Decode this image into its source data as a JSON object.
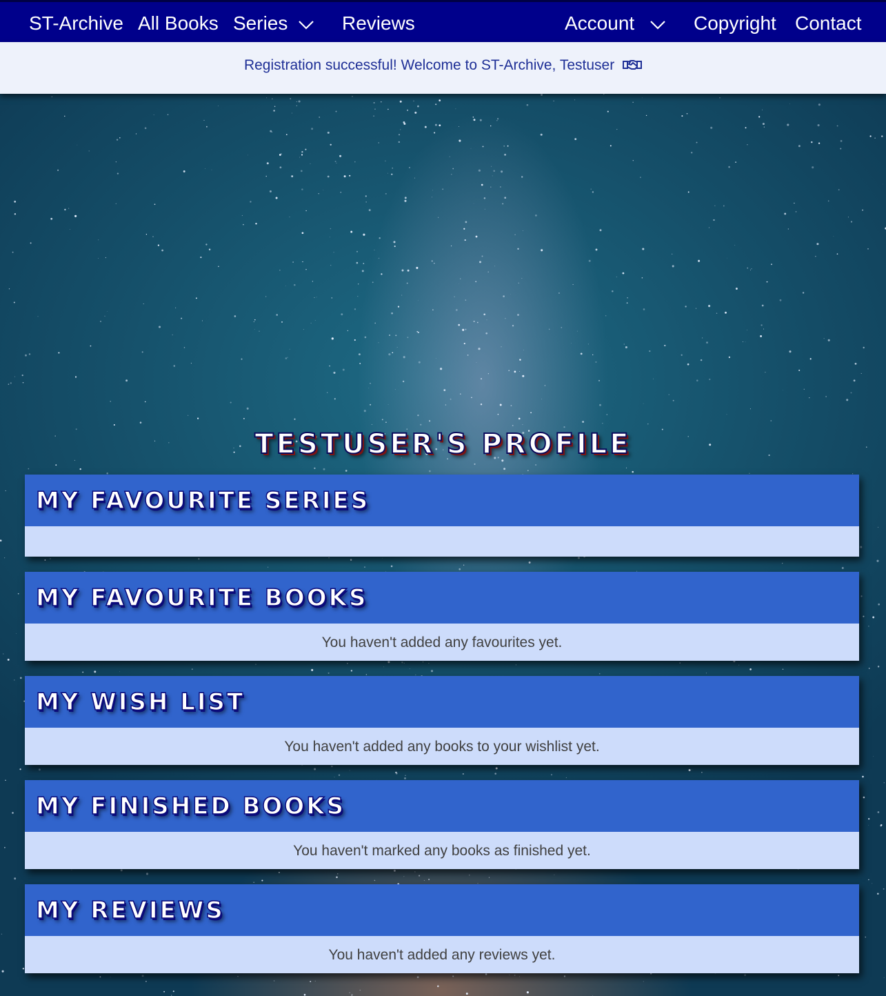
{
  "nav": {
    "brand": "ST-Archive",
    "all_books": "All Books",
    "series": "Series",
    "reviews": "Reviews",
    "account": "Account",
    "copyright": "Copyright",
    "contact": "Contact"
  },
  "flash": {
    "message": "Registration successful! Welcome to ST-Archive, Testuser",
    "icon": "handshake-icon"
  },
  "profile": {
    "title": "Testuser's Profile"
  },
  "sections": [
    {
      "title": "My Favourite Series",
      "empty_text": ""
    },
    {
      "title": "My Favourite Books",
      "empty_text": "You haven't added any favourites yet."
    },
    {
      "title": "My Wish List",
      "empty_text": "You haven't added any books to your wishlist yet."
    },
    {
      "title": "My Finished Books",
      "empty_text": "You haven't marked any books as finished yet."
    },
    {
      "title": "My Reviews",
      "empty_text": "You haven't added any reviews yet."
    }
  ],
  "colors": {
    "navbar": "#00008b",
    "flash_bg": "#eef2fb",
    "flash_text": "#1e2f96",
    "section_header": "#3164cc",
    "section_body": "#cddcfb"
  }
}
